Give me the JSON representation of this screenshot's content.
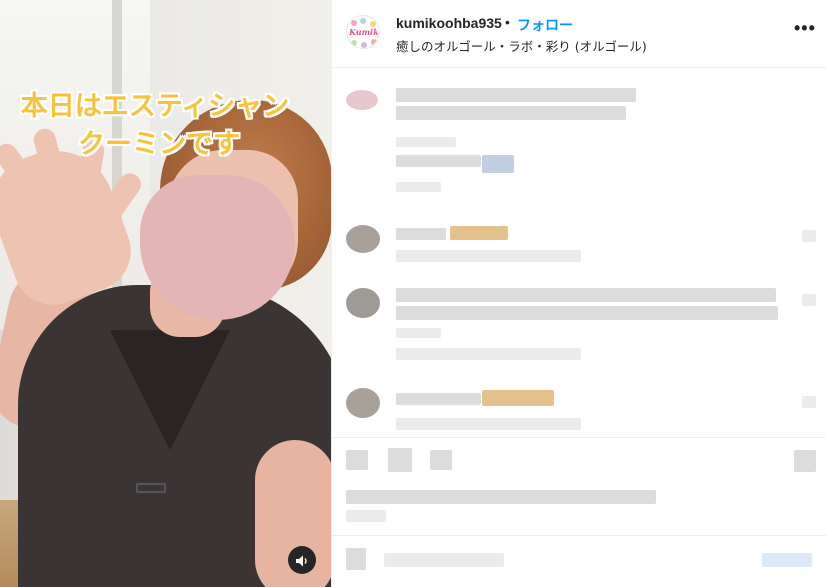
{
  "post": {
    "caption_line1": "本日はエスティシャン",
    "caption_line2": "クーミンです",
    "audio_icon": "speaker-icon"
  },
  "header": {
    "avatar_text": "Kumiko",
    "username": "kumikoohba935",
    "separator": "•",
    "follow_label": "フォロー",
    "subtitle": "癒しのオルゴール・ラボ・彩り (オルゴール)",
    "more_icon": "more-options-icon",
    "more_label": "•••"
  },
  "audio_label": "◀)",
  "colors": {
    "caption": "#f9c23c",
    "follow": "#0095f6",
    "text": "#262626"
  }
}
